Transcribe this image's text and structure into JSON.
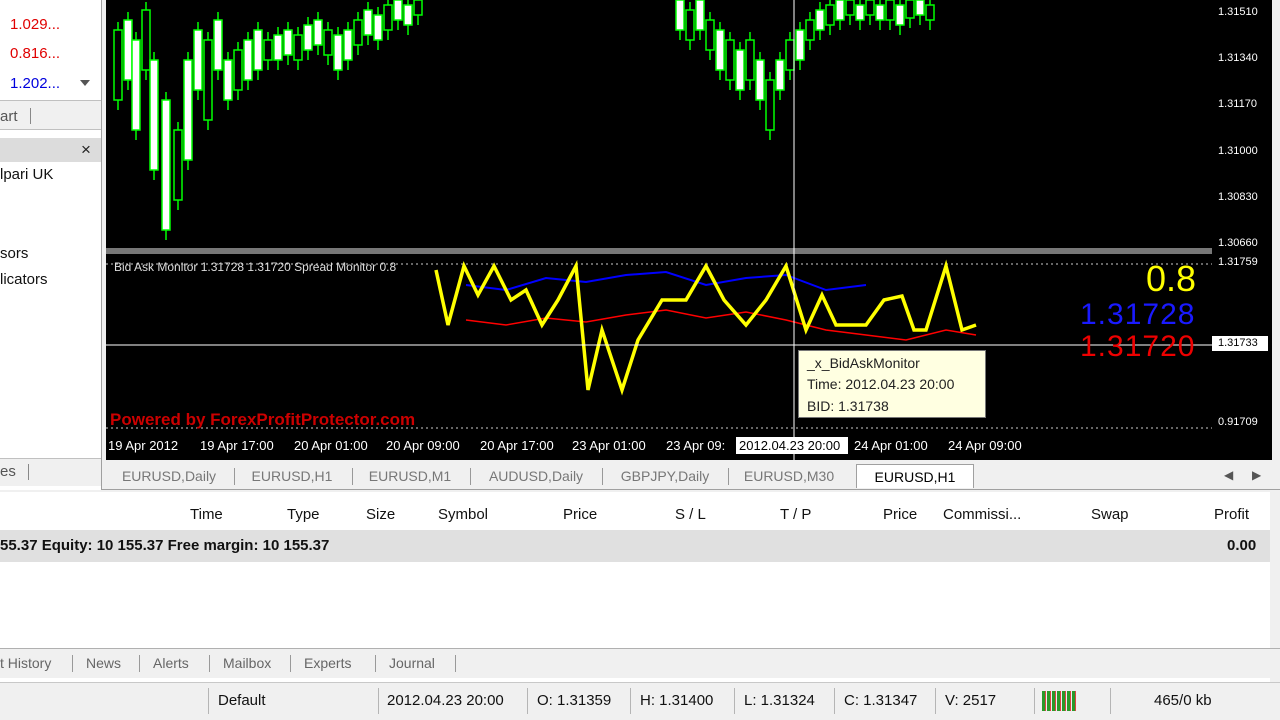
{
  "market_watch": {
    "rows": [
      {
        "value": "1.029...",
        "color": "red"
      },
      {
        "value": "0.816...",
        "color": "red"
      },
      {
        "value": "1.202...",
        "color": "blue"
      }
    ],
    "tab_partial": "art"
  },
  "navigator": {
    "account": "lpari UK",
    "items": [
      "sors",
      "licators"
    ],
    "bottom_tab_partial": "es"
  },
  "chart": {
    "price_scale": [
      "1.31510",
      "1.31340",
      "1.31170",
      "1.31000",
      "1.30830",
      "1.30660"
    ],
    "indicator_scale": [
      "1.31759",
      "1.31733",
      "0.91709"
    ],
    "indicator_title": "Bid Ask Monitor 1.31728 1.31720  Spread Monitor 0.8",
    "spread_value": "0.8",
    "ask_value": "1.31728",
    "bid_value": "1.31720",
    "watermark": "Powered by ForexProfitProtector.com",
    "time_axis": [
      "19 Apr 2012",
      "19 Apr 17:00",
      "20 Apr 01:00",
      "20 Apr 09:00",
      "20 Apr 17:00",
      "23 Apr 01:00",
      "23 Apr 09:",
      "24 Apr 01:00",
      "24 Apr 09:00"
    ],
    "crosshair_time": "2012.04.23 20:00",
    "crosshair_price": "1.31733",
    "tooltip": {
      "title": "_x_BidAskMonitor",
      "time": "Time: 2012.04.23 20:00",
      "bid": "BID: 1.31738"
    },
    "colors": {
      "bull": "#00ff00",
      "yellow_line": "#ffff00",
      "ask_line": "#0000ff",
      "bid_line": "#ff0000"
    }
  },
  "chart_tabs": [
    {
      "label": "EURUSD,Daily",
      "active": false
    },
    {
      "label": "EURUSD,H1",
      "active": false
    },
    {
      "label": "EURUSD,M1",
      "active": false
    },
    {
      "label": "AUDUSD,Daily",
      "active": false
    },
    {
      "label": "GBPJPY,Daily",
      "active": false
    },
    {
      "label": "EURUSD,M30",
      "active": false
    },
    {
      "label": "EURUSD,H1",
      "active": true
    }
  ],
  "terminal": {
    "columns": [
      "Time",
      "Type",
      "Size",
      "Symbol",
      "Price",
      "S / L",
      "T / P",
      "Price",
      "Commissi...",
      "Swap",
      "Profit"
    ],
    "account_line": "55.37  Equity: 10 155.37  Free margin: 10 155.37",
    "profit_total": "0.00",
    "tabs": [
      "t History",
      "News",
      "Alerts",
      "Mailbox",
      "Experts",
      "Journal"
    ]
  },
  "status_bar": {
    "profile": "Default",
    "datetime": "2012.04.23 20:00",
    "open": "O: 1.31359",
    "high": "H: 1.31400",
    "low": "L: 1.31324",
    "close": "C: 1.31347",
    "volume": "V: 2517",
    "traffic": "465/0 kb"
  }
}
